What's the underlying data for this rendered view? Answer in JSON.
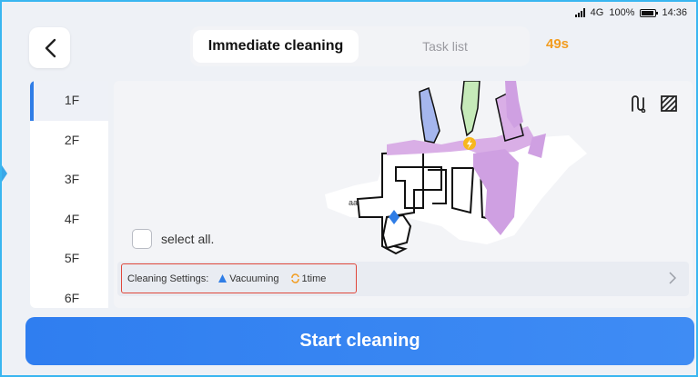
{
  "status_bar": {
    "network": "4G",
    "battery": "100%",
    "time": "14:36"
  },
  "tabs": [
    {
      "label": "Immediate cleaning"
    },
    {
      "label": "Task list"
    }
  ],
  "timer": "49s",
  "floors": [
    "1F",
    "2F",
    "3F",
    "4F",
    "5F",
    "6F"
  ],
  "map": {
    "room_label": "aa"
  },
  "select_all_label": "select all.",
  "settings": {
    "label": "Cleaning Settings:",
    "mode": "Vacuuming",
    "times": "1time"
  },
  "start_button_label": "Start cleaning",
  "colors": {
    "accent": "#2f7ef0",
    "timer": "#f29c1f",
    "highlight_border": "#e0473b"
  }
}
